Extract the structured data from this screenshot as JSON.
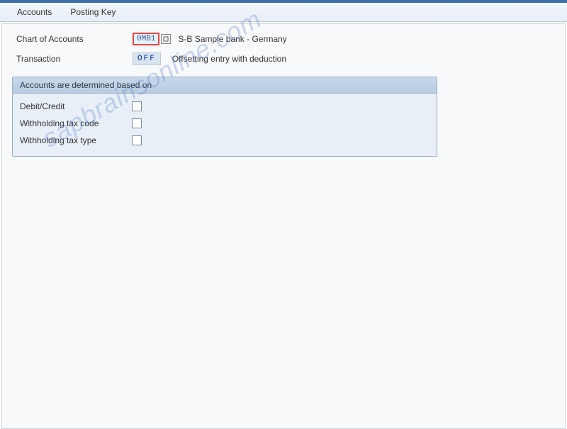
{
  "menu": {
    "accounts": "Accounts",
    "posting_key": "Posting Key"
  },
  "fields": {
    "chart_of_accounts": {
      "label": "Chart of Accounts",
      "value": "0MB1",
      "desc": "S-B Sample bank - Germany"
    },
    "transaction": {
      "label": "Transaction",
      "value": "OFF",
      "desc": "Offsetting entry with deduction"
    }
  },
  "group": {
    "title": "Accounts are determined based on",
    "rows": {
      "debit_credit": "Debit/Credit",
      "wht_code": "Withholding tax code",
      "wht_type": "Withholding tax type"
    }
  },
  "watermark": "sapbrainsonline.com"
}
